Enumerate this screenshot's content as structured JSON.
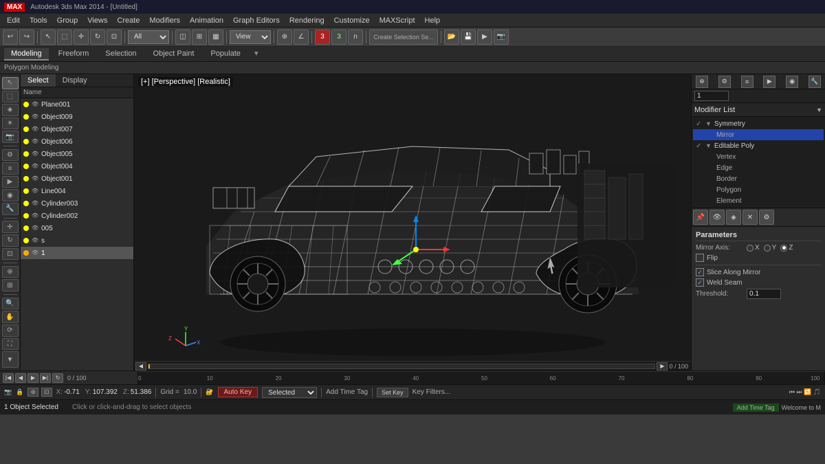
{
  "app": {
    "title": "Autodesk 3ds Max 2014 - [Untitled]",
    "logo": "MAX"
  },
  "menubar": {
    "items": [
      "Edit",
      "Tools",
      "Group",
      "Views",
      "Create",
      "Modifiers",
      "Animation",
      "Graph Editors",
      "Rendering",
      "Customize",
      "MAXScript",
      "Help"
    ]
  },
  "ribbon": {
    "tabs": [
      "Modeling",
      "Freeform",
      "Selection",
      "Object Paint",
      "Populate"
    ],
    "active": "Modeling",
    "breadcrumb": "Polygon Modeling"
  },
  "viewport": {
    "header": "[+] [Perspective] [Realistic]",
    "label": "Perspective"
  },
  "scene": {
    "tabs": [
      "Select",
      "Display"
    ],
    "column": "Name",
    "items": [
      {
        "name": "Plane001",
        "visible": true,
        "selected": false
      },
      {
        "name": "Object009",
        "visible": true,
        "selected": false
      },
      {
        "name": "Object007",
        "visible": true,
        "selected": false
      },
      {
        "name": "Object006",
        "visible": true,
        "selected": false
      },
      {
        "name": "Object005",
        "visible": true,
        "selected": false
      },
      {
        "name": "Object004",
        "visible": true,
        "selected": false
      },
      {
        "name": "Object001",
        "visible": true,
        "selected": false
      },
      {
        "name": "Line004",
        "visible": true,
        "selected": false
      },
      {
        "name": "Cylinder003",
        "visible": true,
        "selected": false
      },
      {
        "name": "Cylinder002",
        "visible": true,
        "selected": false
      },
      {
        "name": "005",
        "visible": true,
        "selected": false
      },
      {
        "name": "s",
        "visible": true,
        "selected": false
      },
      {
        "name": "1",
        "visible": true,
        "selected": true
      }
    ]
  },
  "modifier_panel": {
    "modifier_list_label": "Modifier List",
    "modifiers": [
      {
        "name": "Symmetry",
        "type": "modifier",
        "checked": true,
        "expanded": true
      },
      {
        "name": "Mirror",
        "type": "sub",
        "checked": false,
        "active": true,
        "highlighted": true
      },
      {
        "name": "Editable Poly",
        "type": "modifier",
        "checked": true,
        "expanded": true
      },
      {
        "name": "Vertex",
        "type": "sub"
      },
      {
        "name": "Edge",
        "type": "sub"
      },
      {
        "name": "Border",
        "type": "sub"
      },
      {
        "name": "Polygon",
        "type": "sub"
      },
      {
        "name": "Element",
        "type": "sub"
      }
    ],
    "params_title": "Parameters",
    "mirror_axis_label": "Mirror Axis:",
    "axis_options": [
      "X",
      "Y",
      "Z"
    ],
    "active_axis": "Z",
    "flip_label": "Flip",
    "flip_checked": false,
    "slice_label": "Slice Along Mirror",
    "slice_checked": true,
    "weld_label": "Weld Seam",
    "weld_checked": true,
    "threshold_label": "Threshold:",
    "threshold_value": "0.1"
  },
  "timeline": {
    "current": "0",
    "total": "100",
    "label": "0 / 100",
    "ticks": [
      "0",
      "10",
      "20",
      "30",
      "40",
      "50",
      "60",
      "70",
      "80",
      "90",
      "100"
    ]
  },
  "status": {
    "selection": "1 Object Selected",
    "prompt": "Click or click-and-drag to select objects",
    "x_label": "X:",
    "x_val": "-0.71",
    "y_label": "Y:",
    "y_val": "107.392",
    "z_label": "Z:",
    "z_val": "51.386",
    "grid_label": "Grid =",
    "grid_val": "10.0",
    "auto_key": "Auto Key",
    "selected_dropdown": "Selected",
    "set_key": "Set Key",
    "key_filters": "Key Filters...",
    "add_time_tag": "Add Time Tag",
    "welcome": "Welcome to M"
  }
}
